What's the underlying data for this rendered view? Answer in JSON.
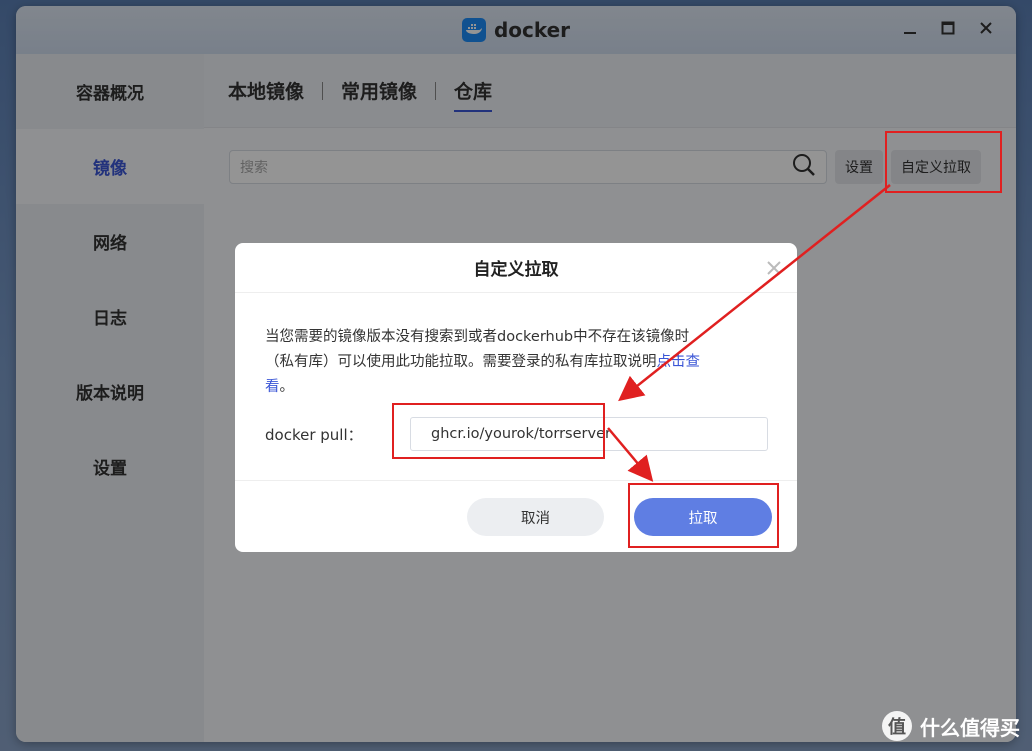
{
  "window": {
    "title": "docker"
  },
  "sidebar": {
    "items": [
      {
        "label": "容器概况"
      },
      {
        "label": "镜像"
      },
      {
        "label": "网络"
      },
      {
        "label": "日志"
      },
      {
        "label": "版本说明"
      },
      {
        "label": "设置"
      }
    ]
  },
  "tabs": [
    {
      "label": "本地镜像"
    },
    {
      "label": "常用镜像"
    },
    {
      "label": "仓库"
    }
  ],
  "toolbar": {
    "search_placeholder": "搜索",
    "settings_label": "设置",
    "custom_pull_label": "自定义拉取"
  },
  "dialog": {
    "title": "自定义拉取",
    "desc_line1": "当您需要的镜像版本没有搜索到或者dockerhub中不存在该镜像时",
    "desc_line2": "（私有库）可以使用此功能拉取。需要登录的私有库拉取说明",
    "desc_link": "点击查",
    "desc_line3_link": "看",
    "desc_line3": "。",
    "pull_label": "docker pull：",
    "pull_value": "ghcr.io/yourok/torrserver",
    "cancel_label": "取消",
    "pull_button_label": "拉取"
  },
  "watermark": {
    "text": "什么值得买",
    "badge": "值"
  },
  "colors": {
    "accent": "#3b56d6",
    "primary_button": "#5f7ee3",
    "highlight": "#e02020"
  }
}
